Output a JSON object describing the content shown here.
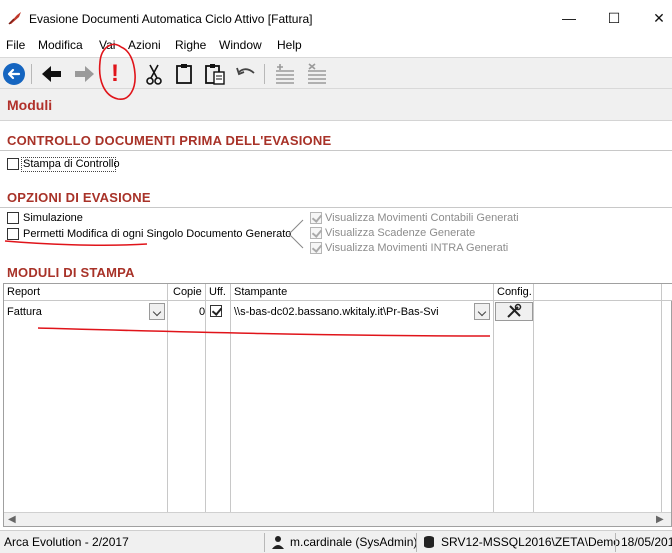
{
  "window": {
    "title": "Evasione Documenti Automatica Ciclo Attivo [Fattura]",
    "minimize": "—",
    "maximize": "☐",
    "close": "✕"
  },
  "menu": [
    "File",
    "Modifica",
    "Vai",
    "Azioni",
    "Righe",
    "Window",
    "Help"
  ],
  "toolbar": {
    "icons": [
      "back-circle-icon",
      "arrow-left-icon",
      "arrow-right-icon",
      "exclamation-icon",
      "cut-icon",
      "clipboard-icon",
      "paste-icon",
      "undo-icon",
      "add-row-icon",
      "delete-row-icon"
    ],
    "exclamation_glyph": "!"
  },
  "page": {
    "title": "Moduli"
  },
  "controllo": {
    "title": "CONTROLLO DOCUMENTI PRIMA DELL'EVASIONE",
    "stampa_di_controllo": {
      "label": "Stampa di Controllo",
      "checked": false
    }
  },
  "opzioni": {
    "title": "OPZIONI DI EVASIONE",
    "simulazione": {
      "label": "Simulazione",
      "checked": false
    },
    "permetti": {
      "label": "Permetti Modifica di ogni Singolo Documento Generato",
      "checked": false
    },
    "sub": [
      {
        "label": "Visualizza Movimenti Contabili Generati",
        "checked": true
      },
      {
        "label": "Visualizza Scadenze Generate",
        "checked": true
      },
      {
        "label": "Visualizza Movimenti INTRA Generati",
        "checked": true
      }
    ]
  },
  "moduli": {
    "title": "MODULI DI STAMPA",
    "columns": {
      "report": "Report",
      "copie": "Copie",
      "uff": "Uff.",
      "stampante": "Stampante",
      "config": "Config."
    },
    "rows": [
      {
        "report": "Fattura",
        "copie": "0",
        "uff": true,
        "stampante": "\\\\s-bas-dc02.bassano.wkitaly.it\\Pr-Bas-Svi"
      }
    ]
  },
  "status": {
    "app": "Arca Evolution - 2/2017",
    "user": "m.cardinale (SysAdmin)",
    "server": "SRV12-MSSQL2016\\ZETA\\Demo",
    "date": "18/05/201"
  },
  "colors": {
    "section_title": "#a83228",
    "annotation": "#e0141a",
    "accent_blue": "#1565c0"
  }
}
